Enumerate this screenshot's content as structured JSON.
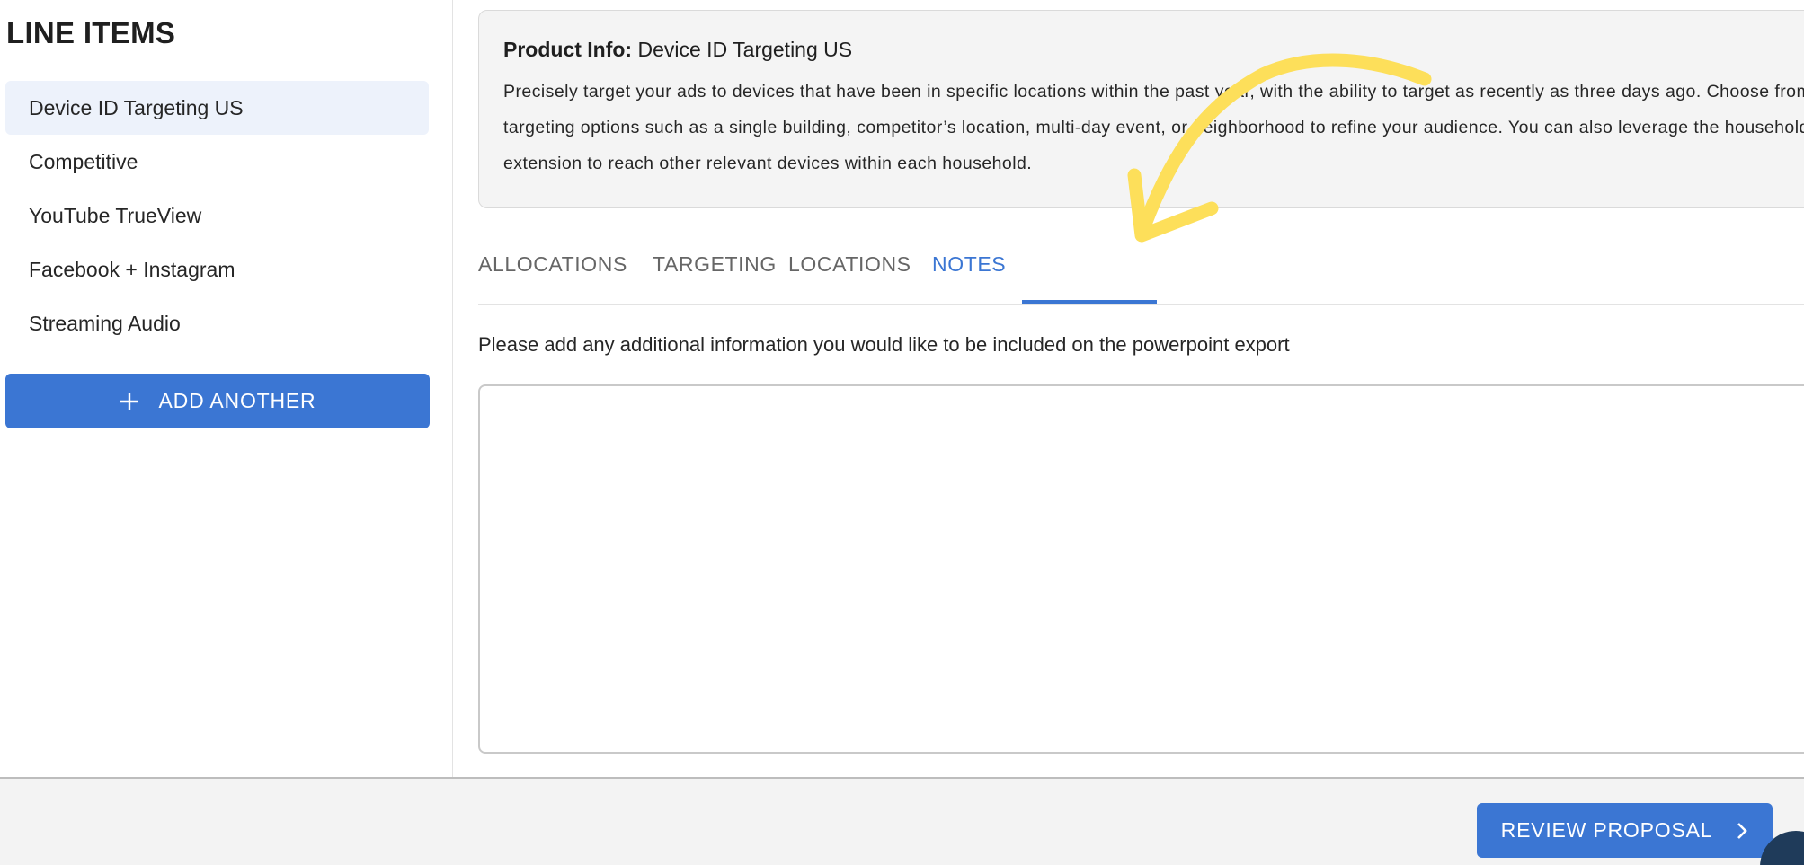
{
  "sidebar": {
    "title": "LINE ITEMS",
    "items": [
      {
        "label": "Device ID Targeting US",
        "active": true
      },
      {
        "label": "Competitive",
        "active": false
      },
      {
        "label": "YouTube TrueView",
        "active": false
      },
      {
        "label": "Facebook + Instagram",
        "active": false
      },
      {
        "label": "Streaming Audio",
        "active": false
      }
    ],
    "add_button": {
      "label": "ADD ANOTHER",
      "icon": "plus-icon"
    }
  },
  "product": {
    "heading_label": "Product Info:",
    "heading_value": "Device ID Targeting US",
    "description": "Precisely target your ads to devices that have been in specific locations within the past year, with the ability to target as recently as three days ago. Choose from targeting options such as a single building, competitor’s location, multi-day event, or neighborhood to refine your audience. You can also leverage the household extension to reach other relevant devices within each household."
  },
  "tabs": [
    {
      "label": "ALLOCATIONS",
      "active": false
    },
    {
      "label": "TARGETING",
      "active": false
    },
    {
      "label": "LOCATIONS",
      "active": false
    },
    {
      "label": "NOTES",
      "active": true
    }
  ],
  "notes": {
    "prompt": "Please add any additional information you would like to be included on the powerpoint export",
    "value": "",
    "placeholder": ""
  },
  "footer": {
    "review_button": {
      "label": "REVIEW PROPOSAL",
      "icon": "chevron-right-icon"
    }
  },
  "colors": {
    "accent": "#3b76d3",
    "active_item_bg": "#edf2fb",
    "annotation": "#fddf5a"
  }
}
